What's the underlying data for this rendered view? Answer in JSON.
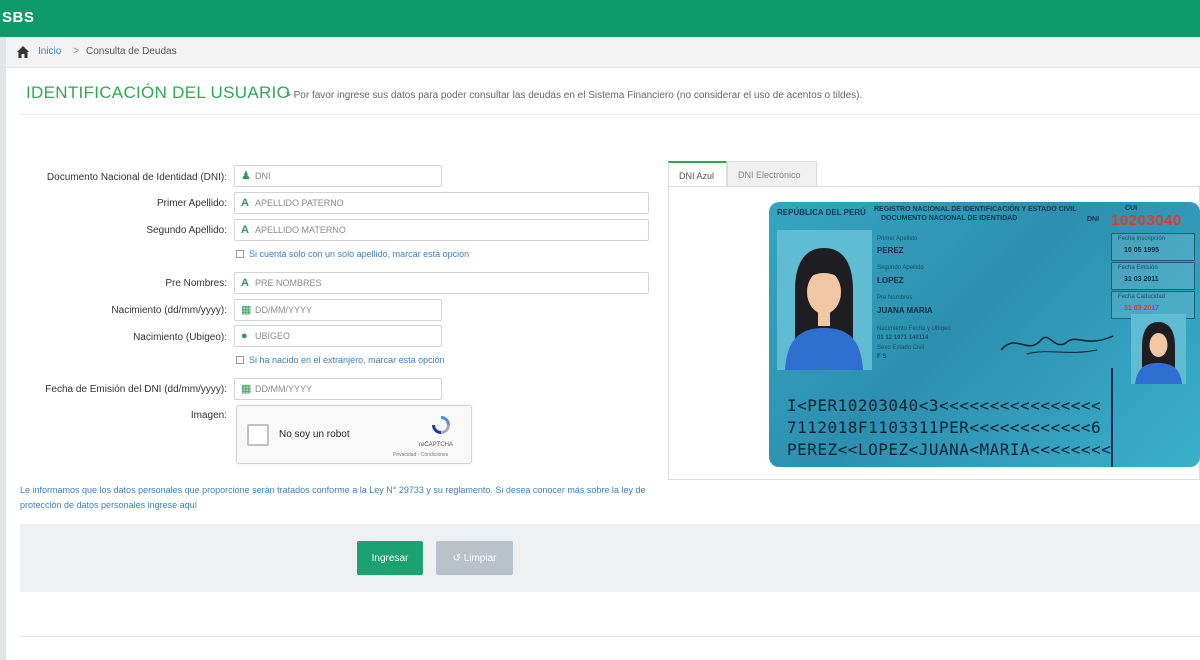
{
  "app": {
    "brand": "SBS"
  },
  "breadcrumb": {
    "home": "Inicio",
    "separator": ">",
    "current": "Consulta de Deudas"
  },
  "header": {
    "title": "IDENTIFICACIÓN DEL USUARIO",
    "subtitle": "> Por favor ingrese sus datos para poder consultar las deudas en el Sistema Financiero (no considerar el uso de acentos o tildes)."
  },
  "form": {
    "dni_label": "Documento Nacional de Identidad (DNI):",
    "dni_placeholder": "DNI",
    "apellido1_label": "Primer Apellido:",
    "apellido1_placeholder": "APELLIDO PATERNO",
    "apellido2_label": "Segundo Apellido:",
    "apellido2_placeholder": "APELLIDO MATERNO",
    "single_surname_check": "Si cuenta solo con un solo apellido, marcar esta opción",
    "nombres_label": "Pre Nombres:",
    "nombres_placeholder": "PRE NOMBRES",
    "nacimiento_label": "Nacimiento (dd/mm/yyyy):",
    "nacimiento_placeholder": "DD/MM/YYYY",
    "ubigeo_label": "Nacimiento (Ubigeo):",
    "ubigeo_placeholder": "UBIGEO",
    "extranjero_check": "Si ha nacido en el extranjero, marcar esta opción",
    "emision_label": "Fecha de Emisión del DNI (dd/mm/yyyy):",
    "emision_placeholder": "DD/MM/YYYY",
    "imagen_label": "Imagen:"
  },
  "captcha": {
    "label": "No soy un robot",
    "brand": "reCAPTCHA",
    "links": "Privacidad - Condiciones"
  },
  "notice": "Le informamos que los datos personales que proporcione serán tratados conforme a la Ley N° 29733 y su reglamento. Si desea conocer más sobre la ley de protección de datos personales ingrese aquí",
  "tabs": [
    {
      "label": "DNI Azul"
    },
    {
      "label": "DNI Electrónico"
    }
  ],
  "dni_card": {
    "republic": "REPÚBLICA DEL PERÚ",
    "registry_line1": "REGISTRO NACIONAL DE IDENTIFICACIÓN Y ESTADO CIVIL",
    "registry_line2": "DOCUMENTO NACIONAL DE IDENTIDAD",
    "dni_tag": "DNI",
    "cui_tag": "CUI",
    "number": "10203040",
    "vertical_number": "10203040",
    "primer_apellido_key": "Primer Apellido",
    "primer_apellido": "PEREZ",
    "segundo_apellido_key": "Segundo Apellido",
    "segundo_apellido": "LOPEZ",
    "nombres_key": "Pre Nombres",
    "nombres": "JUANA MARIA",
    "nacimiento_key": "Nacimiento   Fecha y Ubigeo",
    "nacimiento": "01 12 1971     140114",
    "sexo_key": "Sexo        Estado Civil",
    "sexo": "F              S",
    "inscripcion_key": "Fecha Inscripción",
    "inscripcion": "10 05 1995",
    "emision_key": "Fecha Emisión",
    "emision": "31 03 2011",
    "caducidad_key": "Fecha Caducidad",
    "caducidad": "31 03 2017",
    "mrz1": "I<PER10203040<3<<<<<<<<<<<<<<<<",
    "mrz2": "7112018F1103311PER<<<<<<<<<<<<6",
    "mrz3": "PEREZ<<LOPEZ<JUANA<MARIA<<<<<<<<"
  },
  "actions": {
    "submit": "Ingresar",
    "clear": "Limpiar"
  },
  "colors": {
    "brand_green": "#0e9a6a",
    "title_green": "#2daa4f",
    "link_blue": "#3b7fc4",
    "dni_blue": "#34a6c0",
    "dni_red": "#e23a2a"
  }
}
